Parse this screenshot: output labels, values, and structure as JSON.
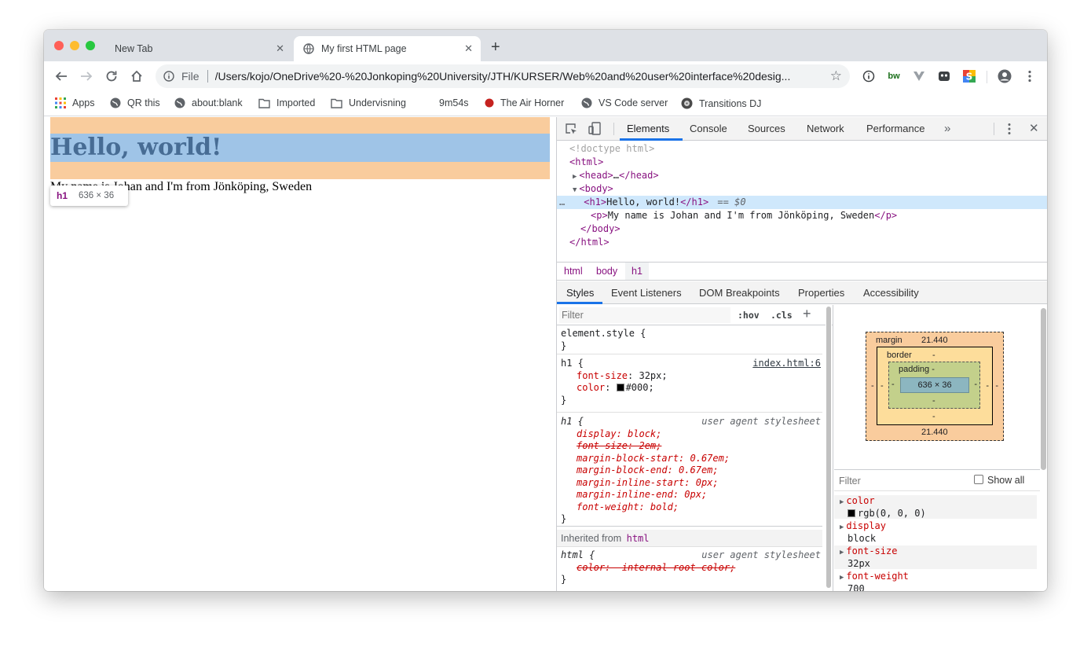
{
  "tabs": [
    {
      "title": "New Tab"
    },
    {
      "title": "My first HTML page"
    }
  ],
  "omnibox": {
    "prefix": "File",
    "url": "/Users/kojo/OneDrive%20-%20Jonkoping%20University/JTH/KURSER/Web%20and%20user%20interface%20desig..."
  },
  "bookmarks": [
    "Apps",
    "QR this",
    "about:blank",
    "Imported",
    "Undervisning",
    "9m54s",
    "The Air Horner",
    "VS Code server",
    "Transitions DJ"
  ],
  "extension_label": "bw",
  "page": {
    "heading": "Hello, world!",
    "paragraph": "My name is Johan and I'm from Jönköping, Sweden"
  },
  "tooltip": {
    "tag": "h1",
    "size": "636 × 36"
  },
  "devtools": {
    "tabs": [
      "Elements",
      "Console",
      "Sources",
      "Network",
      "Performance"
    ],
    "more": "»",
    "dom": {
      "doctype": "<!doctype html>",
      "html_open": "<html>",
      "head_open": "<head>",
      "head_ellipsis": "…",
      "head_close": "</head>",
      "body_open": "<body>",
      "dots": "…",
      "h1_open": "<h1>",
      "h1_text": "Hello, world!",
      "h1_close": "</h1>",
      "h1_marker": "== $0",
      "p_open": "<p>",
      "p_text": "My name is Johan and I'm from Jönköping, Sweden",
      "p_close": "</p>",
      "body_close": "</body>",
      "html_close": "</html>"
    },
    "breadcrumbs": [
      "html",
      "body",
      "h1"
    ],
    "subtabs": [
      "Styles",
      "Event Listeners",
      "DOM Breakpoints",
      "Properties",
      "Accessibility"
    ],
    "styles": {
      "filter_placeholder": "Filter",
      "hov": ":hov",
      "cls": ".cls",
      "plus": "+",
      "element_style": "element.style {",
      "close_brace": "}",
      "rule1_selector": "h1 {",
      "rule1_source": "index.html:6",
      "rule1_p1_name": "font-size",
      "rule1_p1_value": "32px;",
      "rule1_p2_name": "color",
      "rule1_p2_value": "#000;",
      "rule2_selector": "h1 {",
      "rule2_source": "user agent stylesheet",
      "rule2_props": [
        "display: block;",
        "font-size: 2em;",
        "margin-block-start: 0.67em;",
        "margin-block-end: 0.67em;",
        "margin-inline-start: 0px;",
        "margin-inline-end: 0px;",
        "font-weight: bold;"
      ],
      "inherited_label": "Inherited from",
      "inherited_tag": "html",
      "rule3_selector": "html {",
      "rule3_source": "user agent stylesheet",
      "rule3_prop": "color: -internal-root-color;"
    },
    "boxmodel": {
      "margin_label": "margin",
      "margin_top": "21.440",
      "margin_bottom": "21.440",
      "margin_side": "-",
      "border_label": "border",
      "border_value": "-",
      "padding_label": "padding -",
      "padding_value": "-",
      "content": "636 × 36"
    },
    "computed": {
      "filter_placeholder": "Filter",
      "show_all": "Show all",
      "props": [
        {
          "name": "color",
          "value": "rgb(0, 0, 0)"
        },
        {
          "name": "display",
          "value": "block"
        },
        {
          "name": "font-size",
          "value": "32px"
        },
        {
          "name": "font-weight",
          "value": "700"
        }
      ]
    }
  },
  "colors": {
    "margin_overlay": "#f9cc9d",
    "content_overlay": "#9fc4e7",
    "selected_row": "#cfe8fc",
    "accent": "#1a73e8"
  }
}
